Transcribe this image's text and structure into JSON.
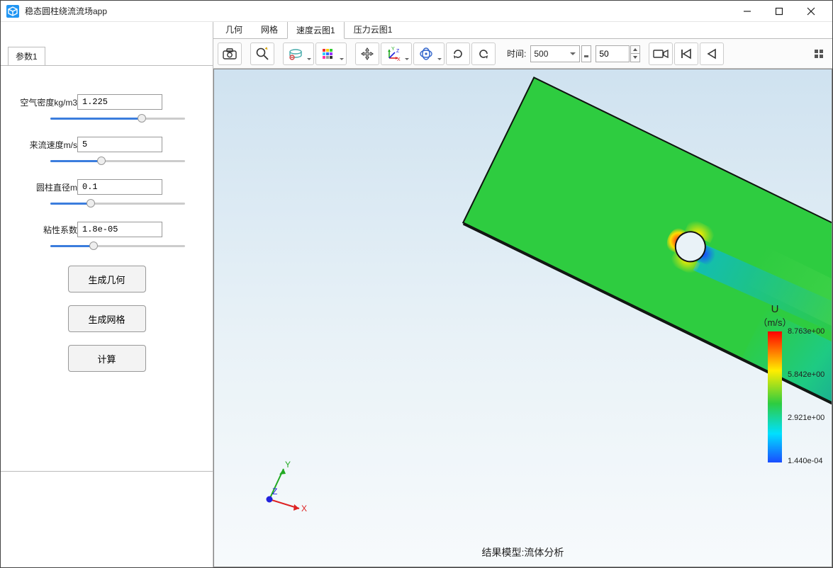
{
  "window": {
    "title": "稳态圆柱绕流流场app"
  },
  "sidebar": {
    "tab": "参数1",
    "params": [
      {
        "label": "空气密度kg/m3",
        "value": "1.225",
        "fill": 68
      },
      {
        "label": "来流速度m/s",
        "value": "5",
        "fill": 38
      },
      {
        "label": "圆柱直径m",
        "value": "0.1",
        "fill": 30
      },
      {
        "label": "粘性系数",
        "value": "1.8e-05",
        "fill": 32
      }
    ],
    "buttons": {
      "geom": "生成几何",
      "mesh": "生成网格",
      "calc": "计算"
    }
  },
  "main": {
    "tabs": [
      "几何",
      "网格",
      "速度云图1",
      "压力云图1"
    ],
    "active_tab": 2,
    "toolbar": {
      "time_label": "时间:",
      "time_select": "500",
      "time_step": "50"
    },
    "caption": "结果模型:流体分析",
    "legend": {
      "title": "U",
      "subtitle": "（m/s）",
      "ticks": [
        {
          "value": "8.763e+00",
          "pos": 0
        },
        {
          "value": "5.842e+00",
          "pos": 33
        },
        {
          "value": "2.921e+00",
          "pos": 66
        },
        {
          "value": "1.440e-04",
          "pos": 99
        }
      ]
    },
    "triad": {
      "x": "X",
      "y": "Y",
      "z": "Z"
    }
  },
  "chart_data": {
    "type": "heatmap",
    "title": "结果模型:流体分析",
    "field": "U",
    "unit": "m/s",
    "range": [
      0.000144,
      8.763
    ],
    "ticks": [
      8.763,
      5.842,
      2.921,
      0.000144
    ],
    "geometry": "flow past a cylinder (rectangular domain with circular hole, rotated ~26°)",
    "notes": "velocity magnitude contour; stagnation (red) upstream of cylinder, low-speed (blue) wake downstream"
  }
}
